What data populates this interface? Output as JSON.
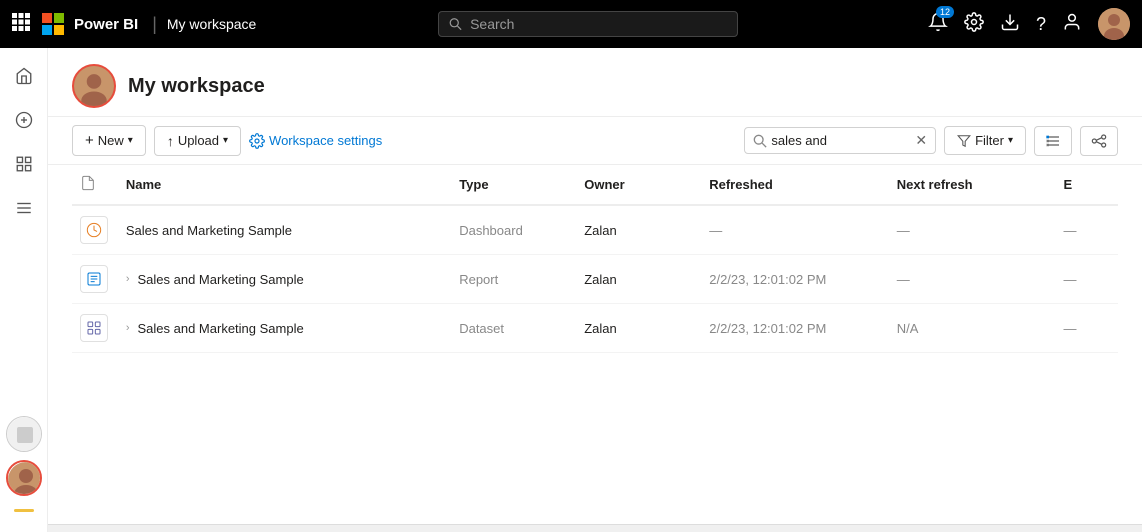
{
  "topnav": {
    "app_name": "Power BI",
    "workspace_name": "My workspace",
    "search_placeholder": "Search",
    "notification_badge": "12",
    "icons": {
      "waffle": "⊞",
      "bell": "🔔",
      "gear": "⚙",
      "download": "⬇",
      "help": "?",
      "account": "👤"
    }
  },
  "sidebar": {
    "items": [
      {
        "name": "home",
        "icon": "⌂",
        "active": false
      },
      {
        "name": "create",
        "icon": "+",
        "active": false
      },
      {
        "name": "browse",
        "icon": "⊡",
        "active": false
      },
      {
        "name": "data-hub",
        "icon": "≡",
        "active": false
      }
    ]
  },
  "workspace": {
    "title": "My workspace",
    "toolbar": {
      "new_label": "New",
      "upload_label": "Upload",
      "settings_label": "Workspace settings",
      "filter_label": "Filter",
      "search_value": "sales and",
      "view_icon": "≡",
      "lineage_icon": "⚟"
    },
    "table": {
      "headers": {
        "name": "Name",
        "type": "Type",
        "owner": "Owner",
        "refreshed": "Refreshed",
        "next_refresh": "Next refresh",
        "e": "E"
      },
      "rows": [
        {
          "icon_type": "dashboard",
          "name": "Sales and Marketing Sample",
          "type": "Dashboard",
          "owner": "Zalan",
          "refreshed": "—",
          "next_refresh": "—",
          "e": "—"
        },
        {
          "icon_type": "report",
          "name": "Sales and Marketing Sample",
          "type": "Report",
          "owner": "Zalan",
          "refreshed": "2/2/23, 12:01:02 PM",
          "next_refresh": "—",
          "e": "—"
        },
        {
          "icon_type": "dataset",
          "name": "Sales and Marketing Sample",
          "type": "Dataset",
          "owner": "Zalan",
          "refreshed": "2/2/23, 12:01:02 PM",
          "next_refresh": "N/A",
          "e": "—"
        }
      ]
    }
  }
}
